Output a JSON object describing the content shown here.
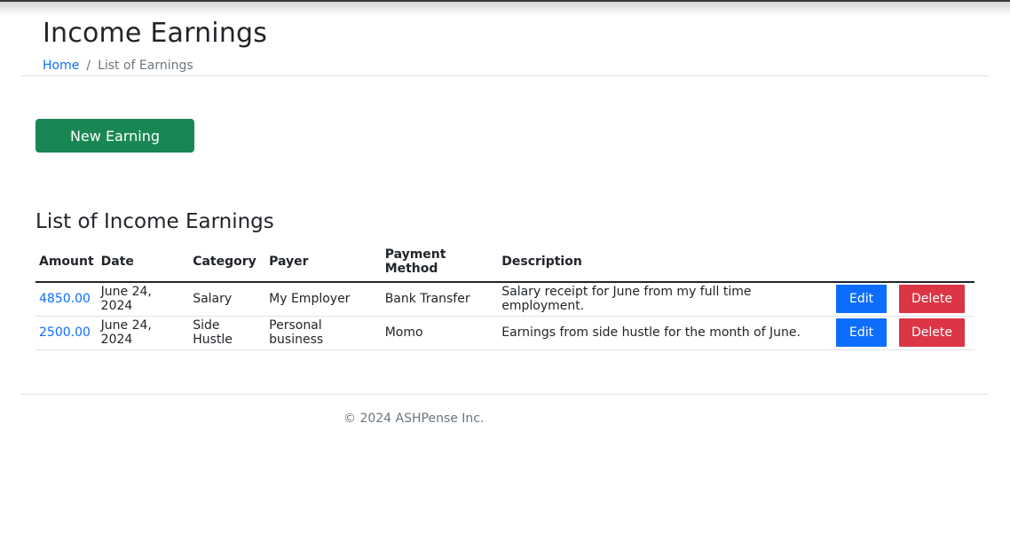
{
  "header": {
    "title": "Income Earnings",
    "breadcrumb": {
      "home": "Home",
      "separator": "/",
      "current": "List of Earnings"
    }
  },
  "actions": {
    "new_label": "New Earning"
  },
  "list": {
    "title": "List of Income Earnings",
    "columns": [
      "Amount",
      "Date",
      "Category",
      "Payer",
      "Payment Method",
      "Description"
    ],
    "rows": [
      {
        "amount": "4850.00",
        "date": "June 24, 2024",
        "category": "Salary",
        "payer": "My Employer",
        "method": "Bank Transfer",
        "description": "Salary receipt for June from my full time employment.",
        "edit": "Edit",
        "delete": "Delete"
      },
      {
        "amount": "2500.00",
        "date": "June 24, 2024",
        "category": "Side Hustle",
        "payer": "Personal business",
        "method": "Momo",
        "description": "Earnings from side hustle for the month of June.",
        "edit": "Edit",
        "delete": "Delete"
      }
    ]
  },
  "footer": {
    "copyright": "© 2024 ASHPense Inc."
  },
  "colors": {
    "primary": "#0d6efd",
    "success": "#198754",
    "danger": "#dc3545",
    "muted": "#6c757d"
  }
}
